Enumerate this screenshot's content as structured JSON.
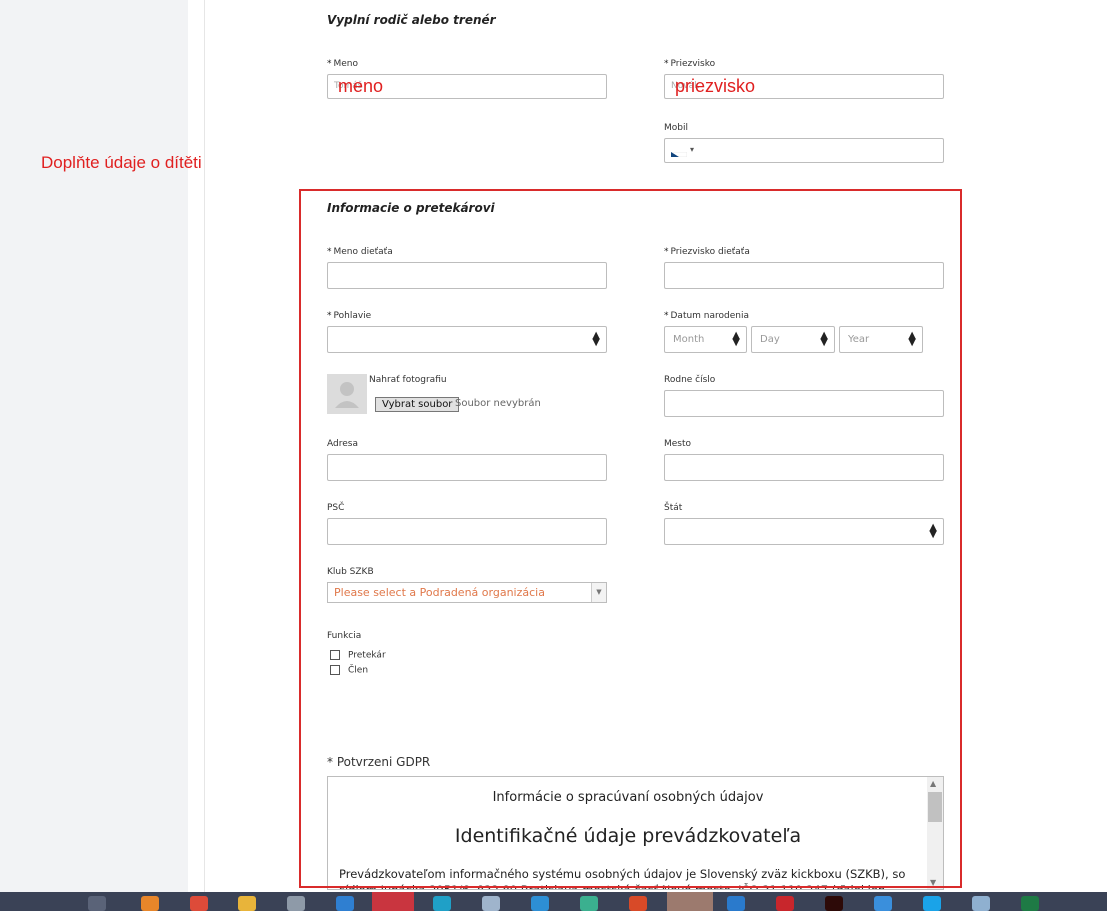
{
  "annotation": "Doplňte údaje o dítěti",
  "parent_section": {
    "title": "Vyplní rodič alebo trenér",
    "first_name": {
      "required": "*",
      "label": "Meno",
      "placeholder": "Tomáš",
      "overlay": "meno"
    },
    "last_name": {
      "required": "*",
      "label": "Priezvisko",
      "placeholder": "Novák",
      "overlay": "priezvisko"
    },
    "mobile": {
      "label": "Mobil",
      "flag": "czech-flag-icon",
      "caret": "▾"
    }
  },
  "racer_section": {
    "title": "Informacie o pretekárovi",
    "child_first_name": {
      "required": "*",
      "label": "Meno dieťaťa"
    },
    "child_last_name": {
      "required": "*",
      "label": "Priezvisko dieťaťa"
    },
    "gender": {
      "required": "*",
      "label": "Pohlavie",
      "value": ""
    },
    "birth_date": {
      "required": "*",
      "label": "Datum narodenia",
      "month": "Month",
      "day": "Day",
      "year": "Year"
    },
    "photo": {
      "label": "Nahrať fotografiu",
      "button": "Vybrat soubor",
      "status": "Soubor nevybrán"
    },
    "birth_number": {
      "label": "Rodne číslo"
    },
    "address": {
      "label": "Adresa"
    },
    "city": {
      "label": "Mesto"
    },
    "zip": {
      "label": "PSČ"
    },
    "state": {
      "label": "Štát",
      "value": ""
    },
    "club": {
      "label": "Klub SZKB",
      "placeholder": "Please select a Podradená organizácia"
    },
    "function": {
      "label": "Funkcia",
      "options": [
        "Pretekár",
        "Člen"
      ]
    }
  },
  "gdpr": {
    "required": "*",
    "label": "Potvrzeni GDPR",
    "heading_small": "Informácie o spracúvaní osobných údajov",
    "heading_large": "Identifikačné údaje prevádzkovateľa",
    "paragraph": "Prevádzkovateľom informačného systému osobných údajov je Slovenský zväz kickboxu (SZKB), so sídlom Junácka 2951/6, 832 80 Bratislava-mestská časť Nové mesto, IČO 31 119 247 (ďalej len „Prevádzkovateľ“)"
  },
  "colors": {
    "annotation": "#e02020",
    "highlight_box": "#d92b2b",
    "taskbar": "#3a4256",
    "club_placeholder": "#e0784a"
  },
  "taskbar_icons": [
    "task-view-icon",
    "firefox-icon",
    "chrome-icon",
    "file-explorer-icon",
    "store-icon",
    "mail-icon",
    "opera-icon",
    "edge-icon",
    "remote-desktop-icon",
    "download-icon",
    "app-icon",
    "office-icon",
    "telegram-icon",
    "vscode-icon",
    "filezilla-icon",
    "illustrator-icon",
    "app2-icon",
    "skype-icon",
    "app3-icon",
    "excel-icon"
  ]
}
